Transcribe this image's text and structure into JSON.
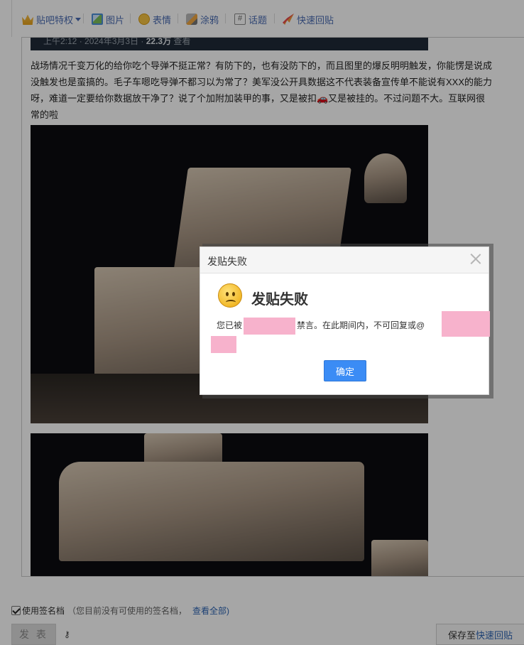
{
  "toolbar": {
    "items": [
      {
        "label": "贴吧特权",
        "icon": "crown-icon"
      },
      {
        "label": "图片",
        "icon": "picture-icon"
      },
      {
        "label": "表情",
        "icon": "emoji-icon"
      },
      {
        "label": "涂鸦",
        "icon": "brush-icon"
      },
      {
        "label": "话题",
        "icon": "hashtag-icon"
      },
      {
        "label": "快速回贴",
        "icon": "rocket-icon"
      }
    ]
  },
  "editor": {
    "quote_prefix": "上午2:12 · 2024年3月3日 · ",
    "quote_views": "22.3万",
    "quote_suffix": " 查看",
    "post_text": "战场情况千变万化的给你吃个导弹不挺正常？有防下的，也有没防下的，而且图里的爆反明明触发，你能愣是说成\n没触发也是蛮搞的。毛子车嗯吃导弹不都习以为常了？美军没公开具数据这不代表装备宣传单不能说有XXX的能力\n呀，难道一定要给你数据放干净了？说了个加附加装甲的事，又是被扣🚗又是被挂的。不过问题不大。互联网很\n常的啦"
  },
  "signature": {
    "checkbox_label": "使用签名档",
    "note": "（您目前没有可使用的签名档，",
    "link": "查看全部)"
  },
  "buttons": {
    "post": "发 表",
    "save_prefix": "保存至",
    "save_link": "快速回贴"
  },
  "dialog": {
    "title": "发贴失败",
    "heading": "发贴失败",
    "msg_part1": "您已被",
    "msg_part2": "禁言。在此期间内，不可回复或@",
    "ok": "确定"
  },
  "colors": {
    "link_blue": "#2d64b3",
    "ok_button": "#3b8cf5",
    "redaction_pink": "#f7b2cc"
  }
}
